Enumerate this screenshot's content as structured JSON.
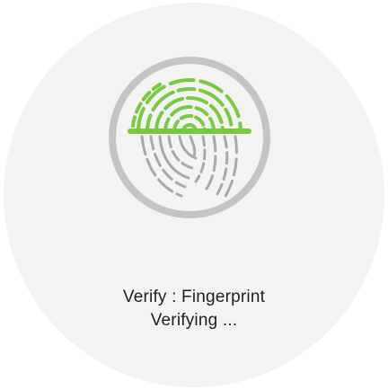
{
  "verify": {
    "title": "Verify : Fingerprint",
    "status": "Verifying ..."
  },
  "icon": {
    "name": "fingerprint-icon",
    "ring_color": "#c4c4c4",
    "scanned_color": "#7ac943",
    "unscanned_color": "#a9a9a9",
    "scan_line_color": "#7ac943"
  },
  "colors": {
    "background": "#ffffff",
    "dial": "#f3f3f3",
    "text": "#1f1f1f"
  }
}
